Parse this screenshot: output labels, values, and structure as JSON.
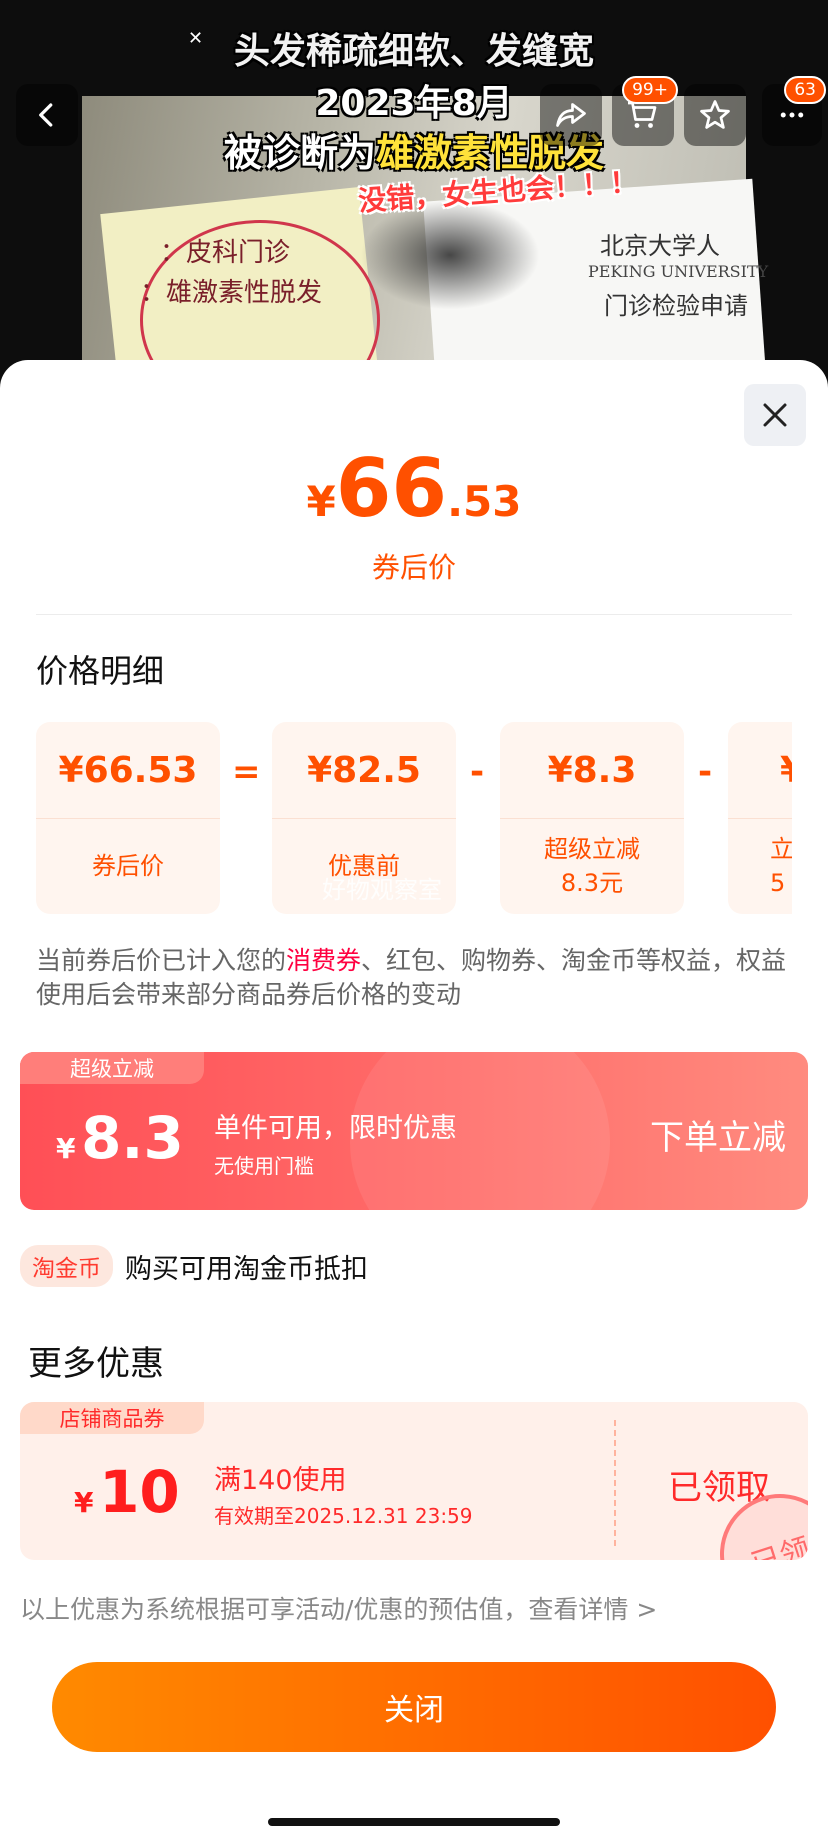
{
  "video": {
    "caption_line1": "头发稀疏细软、发缝宽",
    "caption_line2": "2023年8月",
    "caption_line3_prefix": "被诊断为",
    "caption_line3_highlight": "雄激素性脱发",
    "caption_line4": "没错，女生也会！！！",
    "paper_text_1": "：皮科门诊",
    "paper_text_2": "：雄激素性脱发",
    "paper_text_3": "北京大学人",
    "paper_text_4": "PEKING UNIVERSITY",
    "paper_text_5": "门诊检验申请"
  },
  "nav": {
    "cart_badge": "99+",
    "more_badge": "63"
  },
  "sheet": {
    "price": {
      "currency": "¥",
      "int": "66",
      "dec": ".53",
      "label": "券后价"
    },
    "price_detail_title": "价格明细",
    "breakdown": [
      {
        "value": "¥66.53",
        "label": "券后价",
        "label2": ""
      },
      {
        "value": "¥82.5",
        "label": "优惠前",
        "label2": ""
      },
      {
        "value": "¥8.3",
        "label": "超级立减",
        "label2": "8.3元"
      },
      {
        "value": "¥",
        "label": "立",
        "label2": "5"
      }
    ],
    "operators": [
      "=",
      "-",
      "-"
    ],
    "watermark": "好物观察室",
    "note_part1": "当前券后价已计入您的",
    "note_highlight": "消费券",
    "note_part2": "、红包、购物券、淘金币等权益，权益使用后会带来部分商品券后价格的变动",
    "super_coupon": {
      "tag": "超级立减",
      "currency": "¥",
      "amount": "8.3",
      "desc": "单件可用，限时优惠",
      "sub": "无使用门槛",
      "action": "下单立减"
    },
    "gold": {
      "pill": "淘金币",
      "text": "购买可用淘金币抵扣"
    },
    "more_title": "更多优惠",
    "shop_coupon": {
      "tag": "店铺商品券",
      "currency": "¥",
      "amount": "10",
      "desc": "满140使用",
      "sub": "有效期至2025.12.31 23:59",
      "action": "已领取",
      "stamp": "已领"
    },
    "disclaimer": "以上优惠为系统根据可享活动/优惠的预估值，查看详情 >",
    "close_button": "关闭"
  }
}
